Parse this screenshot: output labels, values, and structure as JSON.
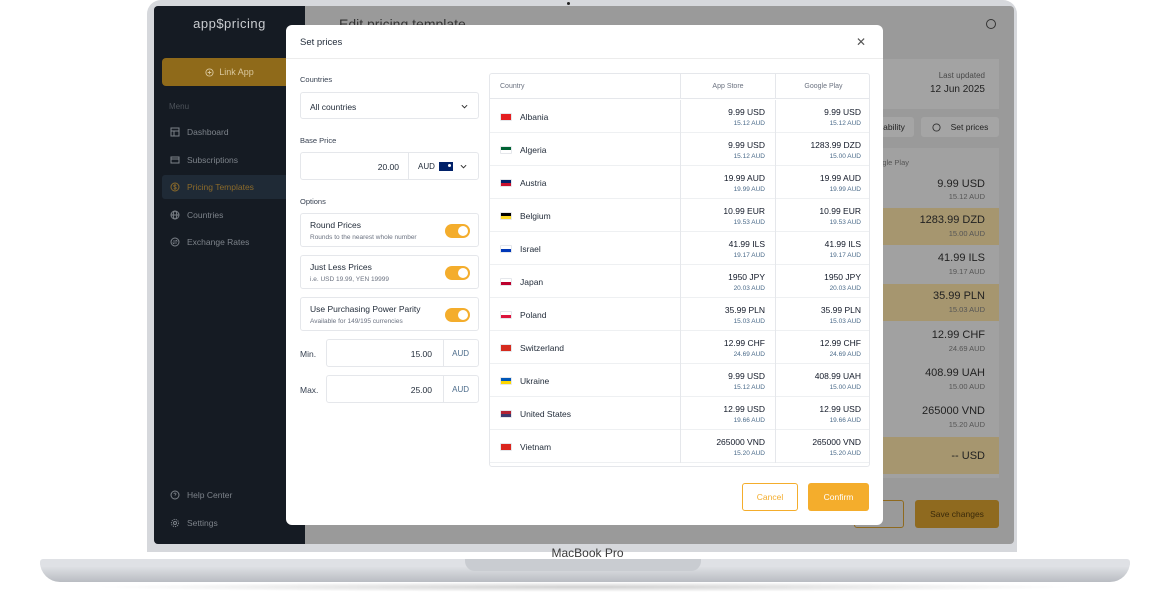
{
  "device_label": "MacBook Pro",
  "sidebar": {
    "logo": "app$pricing",
    "link_app": "Link App",
    "menu_title": "Menu",
    "items": [
      {
        "label": "Dashboard",
        "icon": "dashboard-icon"
      },
      {
        "label": "Subscriptions",
        "icon": "subscriptions-icon"
      },
      {
        "label": "Pricing Templates",
        "icon": "dollar-icon",
        "active": true
      },
      {
        "label": "Countries",
        "icon": "globe-icon"
      },
      {
        "label": "Exchange Rates",
        "icon": "exchange-icon"
      }
    ],
    "bottom_items": [
      {
        "label": "Help Center",
        "icon": "help-icon"
      },
      {
        "label": "Settings",
        "icon": "gear-icon"
      }
    ]
  },
  "background": {
    "page_title": "Edit pricing template",
    "last_updated_label": "Last updated",
    "last_updated_value": "12 Jun 2025",
    "availability_btn": "ability",
    "set_prices_btn": "Set prices",
    "google_play_header": "oogle Play",
    "rows": [
      {
        "price": "9.99 USD",
        "sub": "15.12 AUD"
      },
      {
        "price": "1283.99 DZD",
        "sub": "15.00 AUD"
      },
      {
        "price": "41.99 ILS",
        "sub": "19.17 AUD"
      },
      {
        "price": "35.99 PLN",
        "sub": "15.03 AUD"
      },
      {
        "price": "12.99 CHF",
        "sub": "24.69 AUD"
      },
      {
        "price": "408.99 UAH",
        "sub": "15.00 AUD"
      },
      {
        "price": "265000 VND",
        "sub": "15.20 AUD"
      },
      {
        "price": "-- USD",
        "sub": ""
      }
    ],
    "cancel_label": "es",
    "save_label": "Save changes"
  },
  "modal": {
    "title": "Set prices",
    "countries_label": "Countries",
    "countries_value": "All countries",
    "base_price_label": "Base Price",
    "base_price_value": "20.00",
    "currency": "AUD",
    "options_label": "Options",
    "options": [
      {
        "title": "Round Prices",
        "sub": "Rounds to the nearest whole number",
        "on": true
      },
      {
        "title": "Just Less Prices",
        "sub": "i.e. USD 19.99, YEN 19999",
        "on": true
      },
      {
        "title": "Use Purchasing Power Parity",
        "sub": "Available for 149/195 currencies",
        "on": true
      }
    ],
    "min_label": "Min.",
    "min_value": "15.00",
    "max_label": "Max.",
    "max_value": "25.00",
    "unit": "AUD",
    "table": {
      "headers": [
        "Country",
        "App Store",
        "Google Play"
      ],
      "rows": [
        {
          "country": "Albania",
          "flag": [
            "#e41e20",
            "#e41e20"
          ],
          "app": "9.99 USD",
          "app_sub": "15.12 AUD",
          "gp": "9.99 USD",
          "gp_sub": "15.12 AUD"
        },
        {
          "country": "Algeria",
          "flag": [
            "#006233",
            "#ffffff"
          ],
          "app": "9.99 USD",
          "app_sub": "15.12 AUD",
          "gp": "1283.99 DZD",
          "gp_sub": "15.00 AUD"
        },
        {
          "country": "Austria",
          "flag": [
            "#012169",
            "#c8102e"
          ],
          "app": "19.99 AUD",
          "app_sub": "19.99 AUD",
          "gp": "19.99 AUD",
          "gp_sub": "19.99 AUD"
        },
        {
          "country": "Belgium",
          "flag": [
            "#000000",
            "#fdda24"
          ],
          "app": "10.99 EUR",
          "app_sub": "19.53 AUD",
          "gp": "10.99 EUR",
          "gp_sub": "19.53 AUD"
        },
        {
          "country": "Israel",
          "flag": [
            "#ffffff",
            "#0038b8"
          ],
          "app": "41.99 ILS",
          "app_sub": "19.17 AUD",
          "gp": "41.99 ILS",
          "gp_sub": "19.17 AUD"
        },
        {
          "country": "Japan",
          "flag": [
            "#ffffff",
            "#bc002d"
          ],
          "app": "1950 JPY",
          "app_sub": "20.03 AUD",
          "gp": "1950 JPY",
          "gp_sub": "20.03 AUD"
        },
        {
          "country": "Poland",
          "flag": [
            "#ffffff",
            "#dc143c"
          ],
          "app": "35.99 PLN",
          "app_sub": "15.03 AUD",
          "gp": "35.99 PLN",
          "gp_sub": "15.03 AUD"
        },
        {
          "country": "Switzerland",
          "flag": [
            "#d52b1e",
            "#d52b1e"
          ],
          "app": "12.99 CHF",
          "app_sub": "24.69 AUD",
          "gp": "12.99 CHF",
          "gp_sub": "24.69 AUD"
        },
        {
          "country": "Ukraine",
          "flag": [
            "#0057b7",
            "#ffd700"
          ],
          "app": "9.99 USD",
          "app_sub": "15.12 AUD",
          "gp": "408.99 UAH",
          "gp_sub": "15.00 AUD"
        },
        {
          "country": "United States",
          "flag": [
            "#b22234",
            "#3c3b6e"
          ],
          "app": "12.99 USD",
          "app_sub": "19.66 AUD",
          "gp": "12.99 USD",
          "gp_sub": "19.66 AUD"
        },
        {
          "country": "Vietnam",
          "flag": [
            "#da251d",
            "#da251d"
          ],
          "app": "265000 VND",
          "app_sub": "15.20 AUD",
          "gp": "265000 VND",
          "gp_sub": "15.20 AUD"
        }
      ]
    },
    "cancel": "Cancel",
    "confirm": "Confirm"
  },
  "colors": {
    "accent": "#f4ad2c",
    "sidebar_bg": "#151b23"
  }
}
